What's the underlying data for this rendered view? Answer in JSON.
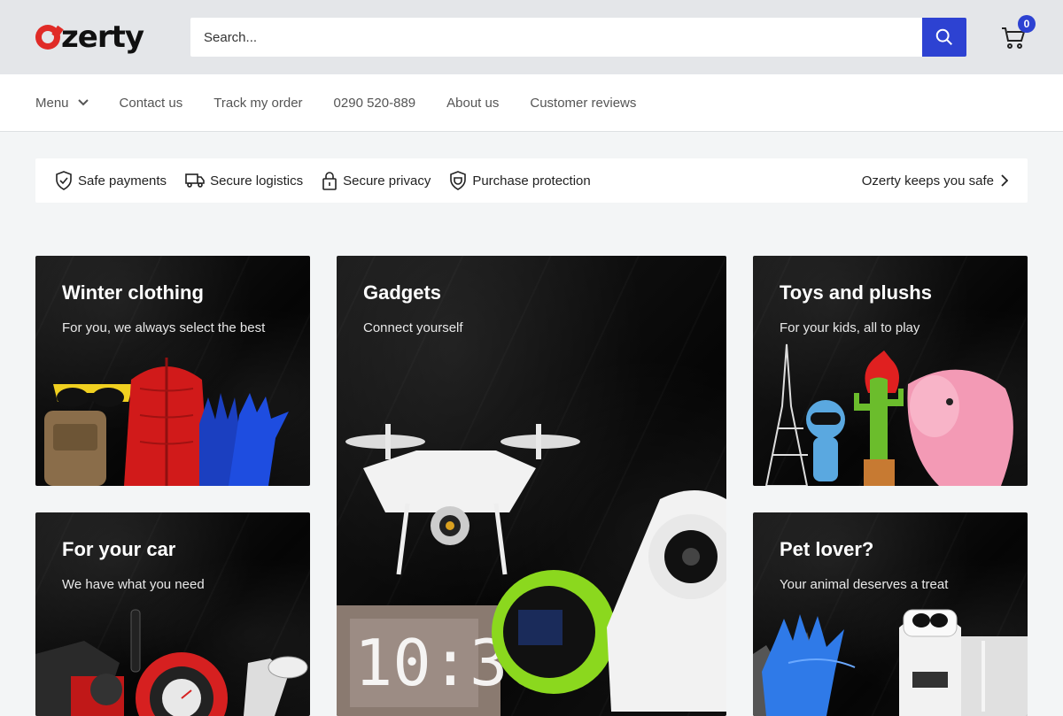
{
  "header": {
    "logo_text": "zerty",
    "search_placeholder": "Search...",
    "cart_count": "0",
    "accent_color": "#2d42d2",
    "brand_color": "#e02b27"
  },
  "nav": {
    "items": [
      "Menu",
      "Contact us",
      "Track my order",
      "0290 520-889",
      "About us",
      "Customer reviews"
    ]
  },
  "trust": {
    "items": [
      {
        "icon": "shield-check-icon",
        "label": "Safe payments"
      },
      {
        "icon": "truck-icon",
        "label": "Secure logistics"
      },
      {
        "icon": "lock-icon",
        "label": "Secure privacy"
      },
      {
        "icon": "shield-badge-icon",
        "label": "Purchase protection"
      }
    ],
    "link_label": "Ozerty keeps you safe"
  },
  "categories": [
    {
      "title": "Winter clothing",
      "subtitle": "For you, we always select the best"
    },
    {
      "title": "Gadgets",
      "subtitle": "Connect yourself"
    },
    {
      "title": "Toys and plushs",
      "subtitle": "For your kids, all to play"
    },
    {
      "title": "For your car",
      "subtitle": "We have what you need"
    },
    {
      "title": "Pet lover?",
      "subtitle": "Your animal deserves a treat"
    }
  ]
}
